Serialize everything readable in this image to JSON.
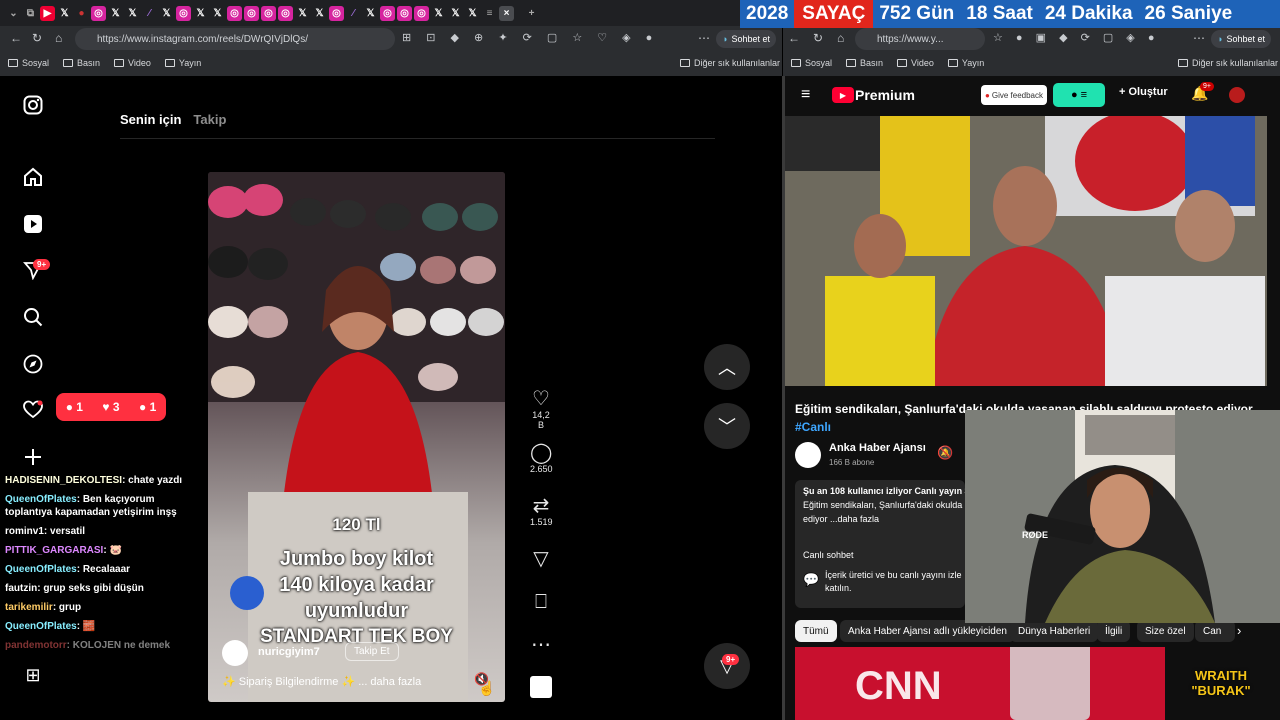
{
  "counter": {
    "year": "2028",
    "label": "SAYAÇ",
    "days": "752 Gün",
    "hours": "18 Saat",
    "minutes": "24 Dakika",
    "seconds": "26 Saniye"
  },
  "browser_left": {
    "url": "https://www.instagram.com/reels/DWrQIVjDlQs/",
    "copilot": "Sohbet et",
    "bookmarks": [
      "Sosyal",
      "Basın",
      "Video",
      "Yayın"
    ],
    "other_bookmarks": "Diğer sık kullanılanlar"
  },
  "browser_right": {
    "url": "https://www.y...",
    "copilot": "Sohbet et",
    "bookmarks": [
      "Sosyal",
      "Basın",
      "Video",
      "Yayın"
    ],
    "other_bookmarks": "Diğer sık kullanılanlar"
  },
  "instagram": {
    "feed_tabs": [
      "Senin için",
      "Takip"
    ],
    "notif_badge": "9+",
    "notif_counts": {
      "comments": "1",
      "likes": "3",
      "follows": "1"
    },
    "reel": {
      "price": "120 Tl",
      "line1": "Jumbo boy kilot",
      "line2": "140 kiloya kadar",
      "line3": "uyumludur",
      "line4": "STANDART TEK BOY",
      "username": "nuricgiyim7",
      "follow_label": "Takip Et",
      "caption": "✨ Sipariş Bilgilendirme ✨ ... daha fazla"
    },
    "actions": {
      "likes": "14,2 B",
      "comments": "2.650",
      "reposts": "1.519"
    },
    "dm_badge": "9+"
  },
  "chat": [
    {
      "user": "HADISENIN_DEKOLTESI",
      "msg": "chate yazdı"
    },
    {
      "user": "QueenOfPlates",
      "msg": "Ben kaçıyorum toplantıya kapamadan yetişirim inşş"
    },
    {
      "user": "rominv1",
      "msg": "versatil"
    },
    {
      "user": "PITTIK_GARGARASI",
      "msg": "🐷"
    },
    {
      "user": "QueenOfPlates",
      "msg": "Recalaaar"
    },
    {
      "user": "fautzin",
      "msg": "grup seks gibi düşün"
    },
    {
      "user": "tarikemilir",
      "msg": "grup"
    },
    {
      "user": "QueenOfPlates",
      "msg": "🧱"
    },
    {
      "user": "pandemotorr",
      "msg": "KOLOJEN ne demek"
    }
  ],
  "youtube": {
    "brand": "Premium",
    "feedback": "Give feedback",
    "create": "Oluştur",
    "bell_badge": "9+",
    "video_title": "Eğitim sendikaları, Şanlıurfa'daki okulda yaşanan silahlı saldırıyı protesto ediyor",
    "hashtag": "#Canlı",
    "channel": "Anka Haber Ajansı",
    "subs": "166 B abone",
    "desc_line1": "Şu an 108 kullanıcı izliyor  Canlı yayın 3",
    "desc_line2": "Eğitim sendikaları, Şanlıurfa'daki okulda",
    "desc_line3": "ediyor ...daha fazla",
    "live_chat": "Canlı sohbet",
    "live_chat_note": "İçerik üretici ve bu canlı yayını izle",
    "live_chat_note2": "katılın.",
    "chips": [
      "Tümü",
      "Anka Haber Ajansı adlı yükleyiciden",
      "Dünya Haberleri",
      "İlgili",
      "Size özel",
      "Can"
    ]
  },
  "overlay": {
    "wraith_line1": "WRAITH",
    "wraith_line2": "\"BURAK\"",
    "rode": "RØDE"
  },
  "colors": {
    "ig_red": "#ff3040",
    "counter_blue": "#1e63b8",
    "counter_red": "#e1261c",
    "yt_red": "#ff0033"
  }
}
